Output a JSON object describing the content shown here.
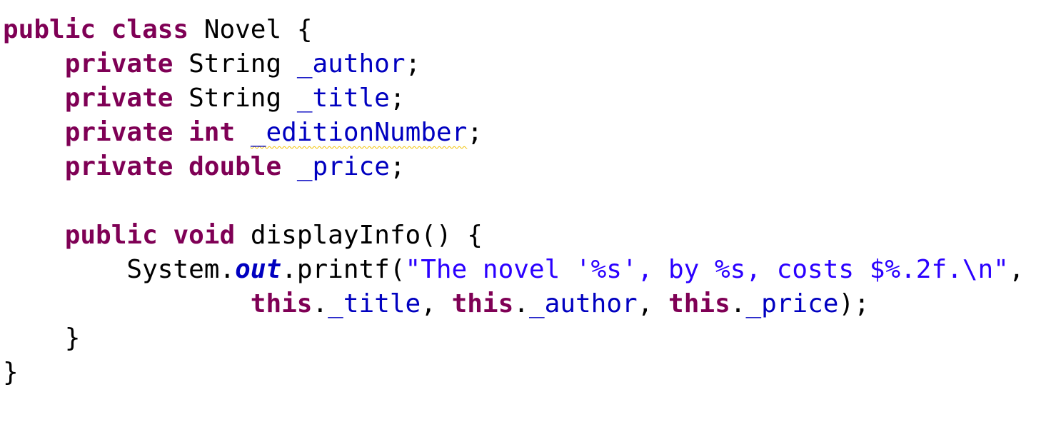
{
  "editor": {
    "lines": [
      [
        {
          "text": "public",
          "kind": "keyword"
        },
        {
          "text": " ",
          "kind": "plain"
        },
        {
          "text": "class",
          "kind": "keyword"
        },
        {
          "text": " Novel {",
          "kind": "plain"
        }
      ],
      [
        {
          "text": "    ",
          "kind": "plain"
        },
        {
          "text": "private",
          "kind": "keyword"
        },
        {
          "text": " String ",
          "kind": "plain"
        },
        {
          "text": "_author",
          "kind": "field"
        },
        {
          "text": ";",
          "kind": "plain"
        }
      ],
      [
        {
          "text": "    ",
          "kind": "plain"
        },
        {
          "text": "private",
          "kind": "keyword"
        },
        {
          "text": " String ",
          "kind": "plain"
        },
        {
          "text": "_title",
          "kind": "field"
        },
        {
          "text": ";",
          "kind": "plain"
        }
      ],
      [
        {
          "text": "    ",
          "kind": "plain"
        },
        {
          "text": "private",
          "kind": "keyword"
        },
        {
          "text": " ",
          "kind": "plain"
        },
        {
          "text": "int",
          "kind": "keyword"
        },
        {
          "text": " ",
          "kind": "plain"
        },
        {
          "text": "_editionNumber",
          "kind": "field",
          "warning": true
        },
        {
          "text": ";",
          "kind": "plain"
        }
      ],
      [
        {
          "text": "    ",
          "kind": "plain"
        },
        {
          "text": "private",
          "kind": "keyword"
        },
        {
          "text": " ",
          "kind": "plain"
        },
        {
          "text": "double",
          "kind": "keyword"
        },
        {
          "text": " ",
          "kind": "plain"
        },
        {
          "text": "_price",
          "kind": "field"
        },
        {
          "text": ";",
          "kind": "plain"
        }
      ],
      [],
      [
        {
          "text": "    ",
          "kind": "plain"
        },
        {
          "text": "public",
          "kind": "keyword"
        },
        {
          "text": " ",
          "kind": "plain"
        },
        {
          "text": "void",
          "kind": "keyword"
        },
        {
          "text": " displayInfo() {",
          "kind": "plain"
        }
      ],
      [
        {
          "text": "        System.",
          "kind": "plain"
        },
        {
          "text": "out",
          "kind": "static-field"
        },
        {
          "text": ".printf(",
          "kind": "plain"
        },
        {
          "text": "\"The novel '%s', by %s, costs $%.2f.\\n\"",
          "kind": "string"
        },
        {
          "text": ",",
          "kind": "plain"
        }
      ],
      [
        {
          "text": "                ",
          "kind": "plain"
        },
        {
          "text": "this",
          "kind": "keyword"
        },
        {
          "text": ".",
          "kind": "plain"
        },
        {
          "text": "_title",
          "kind": "field"
        },
        {
          "text": ", ",
          "kind": "plain"
        },
        {
          "text": "this",
          "kind": "keyword"
        },
        {
          "text": ".",
          "kind": "plain"
        },
        {
          "text": "_author",
          "kind": "field"
        },
        {
          "text": ", ",
          "kind": "plain"
        },
        {
          "text": "this",
          "kind": "keyword"
        },
        {
          "text": ".",
          "kind": "plain"
        },
        {
          "text": "_price",
          "kind": "field"
        },
        {
          "text": ");",
          "kind": "plain"
        }
      ],
      [
        {
          "text": "    }",
          "kind": "plain"
        }
      ],
      [
        {
          "text": "}",
          "kind": "plain"
        }
      ]
    ]
  },
  "colors": {
    "keyword": "#7f0055",
    "field": "#0000c0",
    "string": "#2a00ff",
    "plain": "#000000",
    "warning_underline": "#f0c000",
    "background": "#ffffff"
  }
}
